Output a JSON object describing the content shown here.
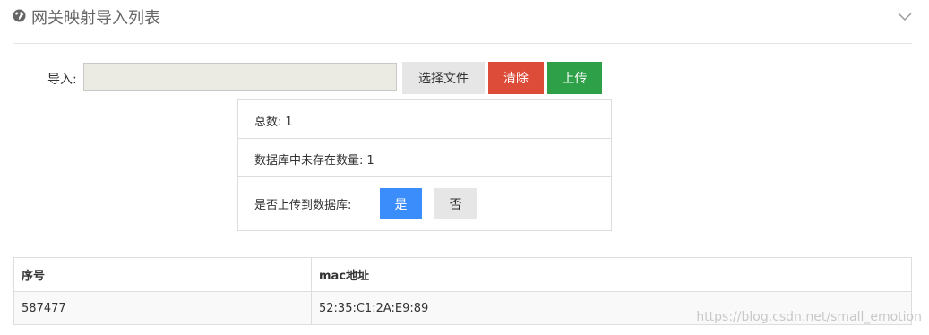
{
  "header": {
    "title": "网关映射导入列表",
    "icon": "globe-icon",
    "collapse_icon": "chevron-down-icon"
  },
  "import": {
    "label": "导入:",
    "file_value": "",
    "choose_label": "选择文件",
    "clear_label": "清除",
    "upload_label": "上传"
  },
  "summary": {
    "total_label": "总数:",
    "total_value": "1",
    "missing_label": "数据库中未存在数量:",
    "missing_value": "1",
    "confirm_label": "是否上传到数据库:",
    "yes_label": "是",
    "no_label": "否"
  },
  "table": {
    "headers": [
      "序号",
      "mac地址"
    ],
    "rows": [
      [
        "587477",
        "52:35:C1:2A:E9:89"
      ]
    ]
  },
  "watermark": "https://blog.csdn.net/small_emotion",
  "colors": {
    "clear": "#dd4b39",
    "upload": "#2ea148",
    "yes": "#3c8dfc"
  }
}
